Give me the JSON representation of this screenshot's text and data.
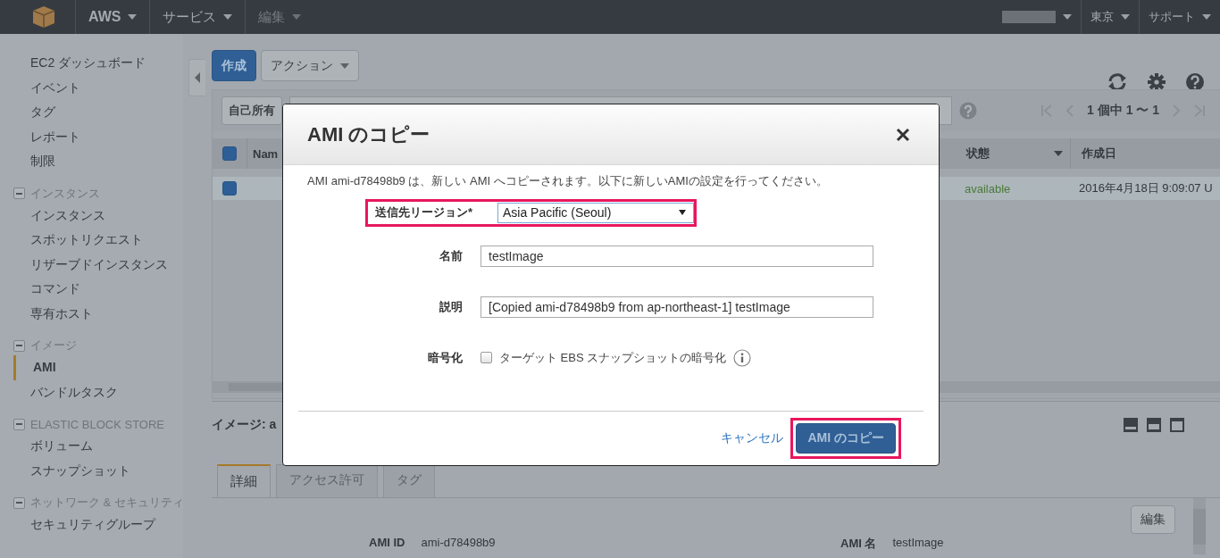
{
  "topbar": {
    "menus": [
      {
        "label": "AWS",
        "kind": "brand"
      },
      {
        "label": "サービス",
        "kind": "menu"
      },
      {
        "label": "編集",
        "kind": "muted"
      }
    ],
    "right_menus": [
      {
        "kind": "redacted"
      },
      {
        "kind": "menu",
        "label": "東京"
      },
      {
        "kind": "menu",
        "label": "サポート"
      }
    ]
  },
  "sidebar": {
    "items": [
      {
        "label": "EC2 ダッシュボード",
        "selected": false
      },
      {
        "label": "イベント",
        "selected": false
      },
      {
        "label": "タグ",
        "selected": false
      },
      {
        "label": "レポート",
        "selected": false
      },
      {
        "label": "制限",
        "selected": false
      }
    ],
    "groups": [
      {
        "label": "インスタンス",
        "expanded": true,
        "children": [
          {
            "label": "インスタンス",
            "selected": false
          },
          {
            "label": "スポットリクエスト",
            "selected": false
          },
          {
            "label": "リザーブドインスタンス",
            "selected": false
          },
          {
            "label": "コマンド",
            "selected": false
          },
          {
            "label": "専有ホスト",
            "selected": false
          }
        ]
      },
      {
        "label": "イメージ",
        "expanded": true,
        "children": [
          {
            "label": "AMI",
            "selected": true
          },
          {
            "label": "バンドルタスク",
            "selected": false
          }
        ]
      },
      {
        "label": "ELASTIC BLOCK STORE",
        "expanded": true,
        "children": [
          {
            "label": "ボリューム",
            "selected": false
          },
          {
            "label": "スナップショット",
            "selected": false
          }
        ]
      },
      {
        "label": "ネットワーク & セキュリティ",
        "expanded": true,
        "children": [
          {
            "label": "セキュリティグループ",
            "selected": false
          }
        ]
      }
    ]
  },
  "toolbar": {
    "create": "作成",
    "actions": "アクション"
  },
  "table": {
    "filter": "自己所有",
    "pagination": "1 個中 1 〜 1",
    "select_all": true,
    "columns": [
      {
        "label": "Nam"
      },
      {
        "label": "状態"
      },
      {
        "label": "作成日"
      }
    ],
    "rows": [
      {
        "selected": true,
        "status": "available",
        "created": "2016年4月18日 9:09:07 U"
      }
    ]
  },
  "details": {
    "title": "イメージ: a",
    "tabs": [
      {
        "label": "詳細",
        "selected": true
      },
      {
        "label": "アクセス許可",
        "selected": false
      },
      {
        "label": "タグ",
        "selected": false
      }
    ],
    "edit": "編集",
    "fields": [
      {
        "label": "AMI ID",
        "value": "ami-d78498b9"
      },
      {
        "label": "AMI 名",
        "value": "testImage"
      }
    ]
  },
  "dialog": {
    "title": "AMI のコピー",
    "intro": "AMI ami-d78498b9 は、新しい AMI へコピーされます。以下に新しいAMIの設定を行ってください。",
    "fields": [
      {
        "kind": "select",
        "label": "送信先リージョン*",
        "value": "Asia Pacific (Seoul)",
        "highlighted": true
      },
      {
        "kind": "text",
        "label": "名前",
        "value": "testImage",
        "highlighted": false
      },
      {
        "kind": "text",
        "label": "説明",
        "value": "[Copied ami-d78498b9 from ap-northeast-1] testImage",
        "highlighted": false
      },
      {
        "kind": "checkbox",
        "label": "暗号化",
        "text": "ターゲット EBS スナップショットの暗号化",
        "checked": false,
        "highlighted": false
      }
    ],
    "cancel": "キャンセル",
    "confirm": {
      "label": "AMI のコピー",
      "highlighted": true
    }
  }
}
